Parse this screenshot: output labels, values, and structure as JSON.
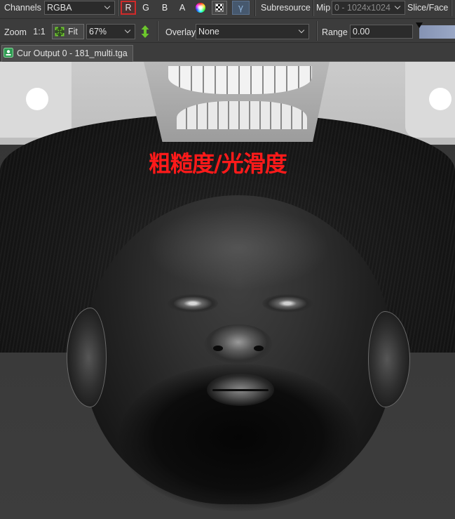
{
  "colors": {
    "toolbar_bg": "#3c3c3c",
    "text": "#e2e2e2",
    "active_channel_border": "#d02a2a",
    "gamma_bg": "#46586e",
    "icon_green": "#6cc62c",
    "range_bar": "#9aa8c6",
    "overlay_text": "#ff1a1a"
  },
  "toolbar": {
    "channels": {
      "label": "Channels",
      "value": "RGBA",
      "buttons": [
        {
          "label": "R",
          "active": true
        },
        {
          "label": "G",
          "active": false
        },
        {
          "label": "B",
          "active": false
        },
        {
          "label": "A",
          "active": false
        }
      ],
      "color_picker_icon": "color-wheel-icon",
      "background_icon": "checkerboard-icon",
      "gamma_label": "γ"
    },
    "subresource": {
      "label": "Subresource",
      "mip_label": "Mip",
      "mip_value": "0 - 1024x1024",
      "slice_label": "Slice/Face"
    },
    "zoom": {
      "label": "Zoom",
      "actual_size_label": "1:1",
      "fit_label": "Fit",
      "fit_icon": "fit-to-window-icon",
      "value": "67%",
      "flip_icon": "vertical-arrows-icon"
    },
    "overlay": {
      "label": "Overlay",
      "value": "None"
    },
    "range": {
      "label": "Range",
      "min_value": "0.00"
    }
  },
  "tabs": [
    {
      "label": "Cur Output 0 - 181_multi.tga",
      "icon": "texture-tab-icon",
      "active": true
    }
  ],
  "viewer": {
    "overlay_text": "粗糙度/光滑度"
  }
}
